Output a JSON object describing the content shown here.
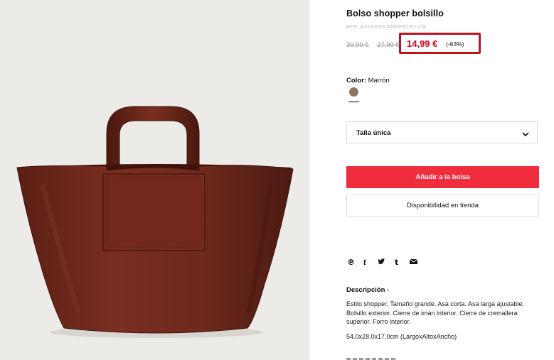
{
  "product": {
    "title": "Bolso shopper bolsillo",
    "ref": "REF. 87000093-AMBERLEY-LM",
    "prices": {
      "original": "39,99 €",
      "previous": "27,99 €",
      "sale": "14,99 €",
      "discount": "(-63%)"
    },
    "color": {
      "label": "Color:",
      "value": "Marrón",
      "swatch": "#8b7663"
    },
    "size": {
      "selected": "Talla única"
    },
    "actions": {
      "add_to_bag": "Añadir a la bolsa",
      "store_availability": "Disponibilidad en tienda"
    },
    "share_icons": [
      "pinterest-icon",
      "facebook-icon",
      "twitter-icon",
      "tumblr-icon",
      "email-icon"
    ],
    "description": {
      "title": "Descripción -",
      "text": "Estilo shopper. Tamaño grande. Asa corta. Asa larga ajustable. Bolsillo exterior. Cierre de imán interior. Cierre de cremallera superior. Forro interior.",
      "dimensions": "54.0x28.0x17.0cm (LargoxAltoxAncho)"
    }
  },
  "colors": {
    "accent": "#f02d3c",
    "sale": "#e2001a",
    "highlight": "#c1121f",
    "bag": "#6e2a1d"
  }
}
